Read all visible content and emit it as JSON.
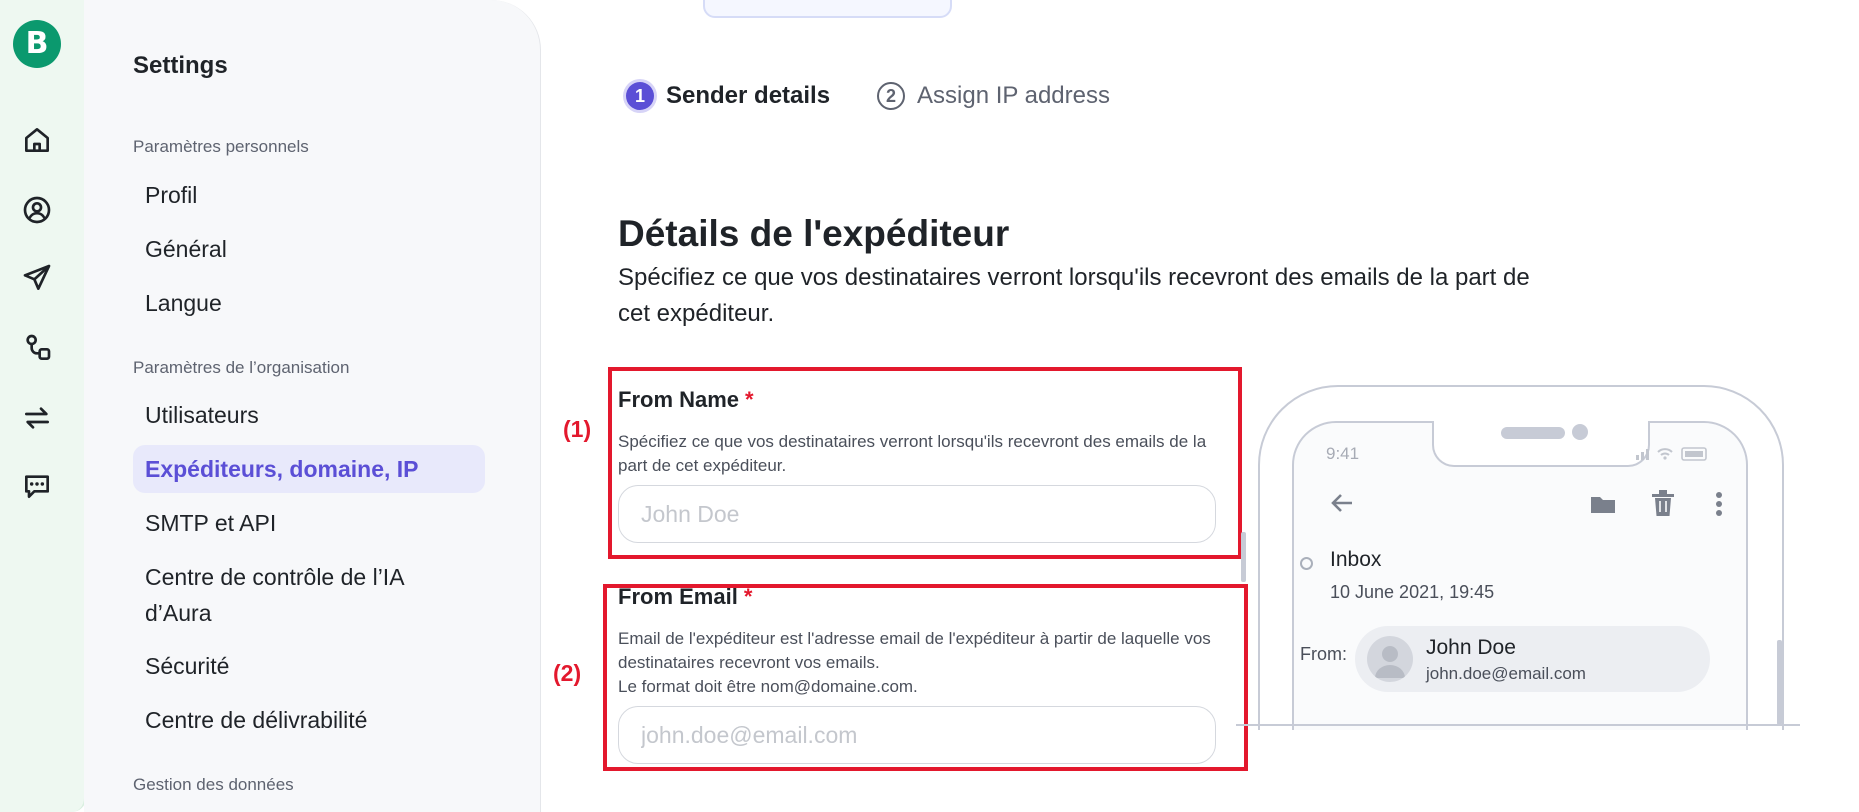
{
  "app": {
    "logo_letter": "B"
  },
  "rail": {
    "icons": [
      "home-icon",
      "contacts-icon",
      "campaigns-icon",
      "automations-icon",
      "transactional-icon",
      "conversations-icon"
    ]
  },
  "settings": {
    "title": "Settings",
    "personal_section": "Paramètres personnels",
    "personal_items": [
      "Profil",
      "Général",
      "Langue"
    ],
    "org_section": "Paramètres de l’organisation",
    "org_items": [
      "Utilisateurs",
      "Expéditeurs, domaine, IP",
      "SMTP et API",
      "Centre de contrôle de l’IA d’Aura",
      "Sécurité",
      "Centre de délivrabilité"
    ],
    "active_item": "Expéditeurs, domaine, IP",
    "data_section": "Gestion des données"
  },
  "stepper": {
    "steps": [
      {
        "number": "1",
        "label": "Sender details",
        "state": "active"
      },
      {
        "number": "2",
        "label": "Assign IP address",
        "state": "inactive"
      }
    ]
  },
  "main": {
    "title": "Détails de l'expéditeur",
    "description": "Spécifiez ce que vos destinataires verront lorsqu'ils recevront des emails de la part de cet expéditeur."
  },
  "form": {
    "from_name": {
      "label": "From Name",
      "required_mark": "*",
      "help": "Spécifiez ce que vos destinataires verront lorsqu'ils recevront des emails de la part de cet expéditeur.",
      "placeholder": "John Doe",
      "value": ""
    },
    "from_email": {
      "label": "From Email",
      "required_mark": "*",
      "help_line1": "Email de l'expéditeur est l'adresse email de l'expéditeur à partir de laquelle vos destinataires recevront vos emails.",
      "help_line2": "Le format doit être nom@domaine.com.",
      "placeholder": "john.doe@email.com",
      "value": ""
    }
  },
  "annotations": {
    "label1": "(1)",
    "label2": "(2)",
    "color": "#e3182d"
  },
  "preview": {
    "time": "9:41",
    "folder": "Inbox",
    "date": "10 June 2021, 19:45",
    "from_label": "From:",
    "sender_name": "John Doe",
    "sender_email": "john.doe@email.com"
  },
  "colors": {
    "brand": "#0b996e",
    "accent": "#5b4fd6",
    "rail_bg": "#eef8f1",
    "active_nav_bg": "#e8e9fb"
  }
}
